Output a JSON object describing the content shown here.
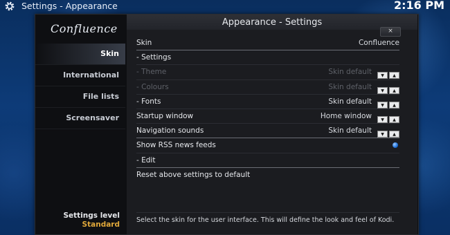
{
  "topbar": {
    "app": "Settings",
    "separator": "-",
    "section": "Appearance",
    "clock": "2:16 PM"
  },
  "logo": "Confluence",
  "dialog": {
    "title": "Appearance - Settings",
    "close": "×"
  },
  "sidebar": {
    "items": [
      {
        "label": "Skin"
      },
      {
        "label": "International"
      },
      {
        "label": "File lists"
      },
      {
        "label": "Screensaver"
      }
    ],
    "level_label": "Settings level",
    "level_value": "Standard"
  },
  "settings": {
    "rows": [
      {
        "label": "Skin",
        "value": "Confluence"
      },
      {
        "label": "- Settings",
        "value": ""
      },
      {
        "label": "- Theme",
        "value": "Skin default"
      },
      {
        "label": "- Colours",
        "value": "Skin default"
      },
      {
        "label": "- Fonts",
        "value": "Skin default"
      },
      {
        "label": "Startup window",
        "value": "Home window"
      },
      {
        "label": "Navigation sounds",
        "value": "Skin default"
      },
      {
        "label": "Show RSS news feeds",
        "value": ""
      },
      {
        "label": "- Edit",
        "value": ""
      },
      {
        "label": "Reset above settings to default",
        "value": ""
      }
    ],
    "rss_enabled": true
  },
  "help_text": "Select the skin for the user interface. This will define the look and feel of Kodi.",
  "colors": {
    "accent_orange": "#e0a83a",
    "radio_blue": "#1e6fd8",
    "background_blue": "#0d3b78"
  }
}
